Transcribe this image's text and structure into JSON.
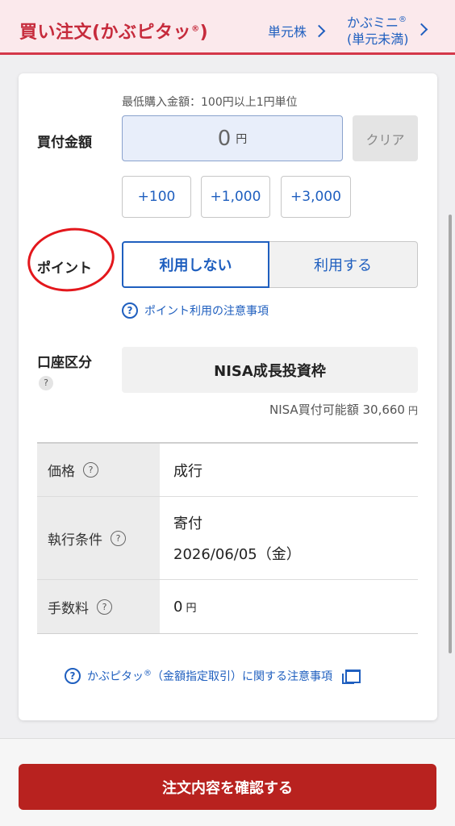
{
  "header": {
    "title": "買い注文(かぶピタッ",
    "title_mark": "®",
    "title_close": ")",
    "link1_label": "単元株",
    "link2_line1": "かぶミニ",
    "link2_mark": "®",
    "link2_line2": "(単元未満)"
  },
  "amount": {
    "min_note": "最低購入金額：100円以上1円単位",
    "label": "買付金額",
    "value": "0",
    "unit": "円",
    "clear_label": "クリア",
    "increments": [
      "+100",
      "+1,000",
      "+3,000"
    ]
  },
  "point": {
    "label": "ポイント",
    "option_off": "利用しない",
    "option_on": "利用する",
    "selected": "利用しない",
    "note": "ポイント利用の注意事項",
    "annotation_color": "#e3171c"
  },
  "account": {
    "label": "口座区分",
    "help": "?",
    "value": "NISA成長投資枠",
    "avail_label": "NISA買付可能額",
    "avail_value": "30,660",
    "avail_unit": "円"
  },
  "table": {
    "rows": [
      {
        "label": "価格",
        "value": "成行"
      },
      {
        "label": "執行条件",
        "value": "寄付",
        "value2": "2026/06/05（金）"
      },
      {
        "label": "手数料",
        "value": "0",
        "unit": "円"
      }
    ]
  },
  "footer_note": {
    "text_pre": "かぶピタッ",
    "mark": "®",
    "text_post": "（金額指定取引）に関する注意事項"
  },
  "confirm_button": "注文内容を確認する",
  "colors": {
    "brand_red": "#c62b3c",
    "link_blue": "#1f5fbf",
    "button_red": "#b8221f"
  }
}
